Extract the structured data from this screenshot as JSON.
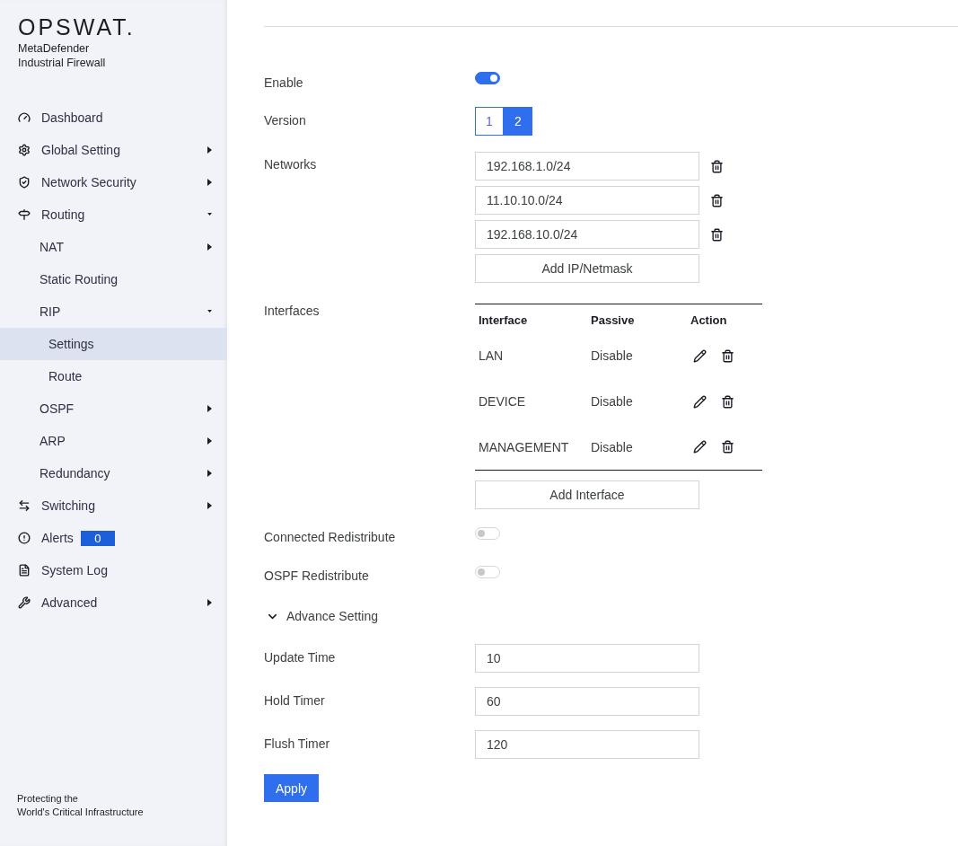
{
  "brand": {
    "logo": "OPSWAT.",
    "product_lines": [
      "MetaDefender",
      "Industrial Firewall"
    ]
  },
  "sidebar": {
    "items": [
      {
        "label": "Dashboard",
        "selected": false
      },
      {
        "label": "Global Setting",
        "selected": false,
        "expanded": false
      },
      {
        "label": "Network Security",
        "selected": false,
        "expanded": false
      },
      {
        "label": "Routing",
        "selected": false,
        "expanded": true,
        "children": [
          {
            "label": "NAT",
            "selected": false,
            "expanded": false
          },
          {
            "label": "Static Routing",
            "selected": false
          },
          {
            "label": "RIP",
            "selected": false,
            "expanded": true,
            "children": [
              {
                "label": "Settings",
                "selected": true
              },
              {
                "label": "Route",
                "selected": false
              }
            ]
          },
          {
            "label": "OSPF",
            "selected": false,
            "expanded": false
          },
          {
            "label": "ARP",
            "selected": false,
            "expanded": false
          },
          {
            "label": "Redundancy",
            "selected": false,
            "expanded": false
          }
        ]
      },
      {
        "label": "Switching",
        "selected": false,
        "expanded": false
      },
      {
        "label": "Alerts",
        "selected": false,
        "badge": "0"
      },
      {
        "label": "System Log",
        "selected": false
      },
      {
        "label": "Advanced",
        "selected": false,
        "expanded": false
      }
    ],
    "footer_lines": [
      "Protecting the",
      "World's Critical Infrastructure"
    ]
  },
  "form": {
    "enable": {
      "label": "Enable",
      "on": true
    },
    "version": {
      "label": "Version",
      "options": [
        {
          "label": "1",
          "selected": false
        },
        {
          "label": "2",
          "selected": true
        }
      ]
    },
    "networks": {
      "label": "Networks",
      "values": [
        "192.168.1.0/24",
        "11.10.10.0/24",
        "192.168.10.0/24"
      ],
      "add_button": "Add IP/Netmask"
    },
    "interfaces": {
      "label": "Interfaces",
      "columns": [
        "Interface",
        "Passive",
        "Action"
      ],
      "rows": [
        {
          "interface": "LAN",
          "passive": "Disable"
        },
        {
          "interface": "DEVICE",
          "passive": "Disable"
        },
        {
          "interface": "MANAGEMENT",
          "passive": "Disable"
        }
      ],
      "add_button": "Add Interface"
    },
    "connected_redistribute": {
      "label": "Connected Redistribute",
      "on": false
    },
    "ospf_redistribute": {
      "label": "OSPF Redistribute",
      "on": false
    },
    "advance_setting": {
      "label": "Advance Setting",
      "expanded": true,
      "fields": [
        {
          "label": "Update Time",
          "value": "10"
        },
        {
          "label": "Hold Timer",
          "value": "60"
        },
        {
          "label": "Flush Timer",
          "value": "120"
        }
      ]
    },
    "apply_button": "Apply"
  }
}
